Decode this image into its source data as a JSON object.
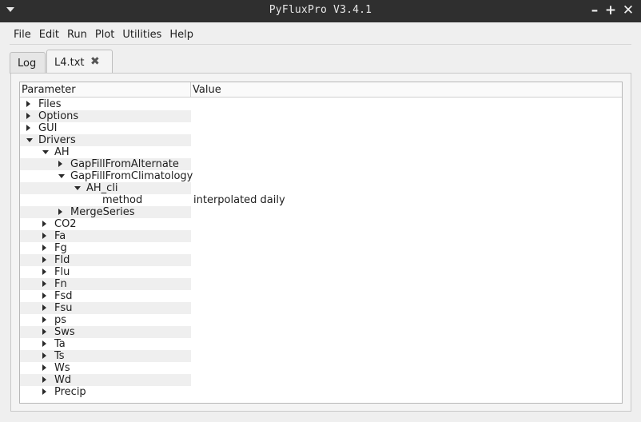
{
  "window": {
    "title": "PyFluxPro V3.4.1"
  },
  "menu": [
    "File",
    "Edit",
    "Run",
    "Plot",
    "Utilities",
    "Help"
  ],
  "tabs": {
    "log": "Log",
    "active": "L4.txt"
  },
  "tree": {
    "headers": {
      "parameter": "Parameter",
      "value": "Value"
    },
    "rows": [
      {
        "label": "Files",
        "level": 0,
        "state": "collapsed"
      },
      {
        "label": "Options",
        "level": 0,
        "state": "collapsed"
      },
      {
        "label": "GUI",
        "level": 0,
        "state": "collapsed"
      },
      {
        "label": "Drivers",
        "level": 0,
        "state": "expanded"
      },
      {
        "label": "AH",
        "level": 1,
        "state": "expanded"
      },
      {
        "label": "GapFillFromAlternate",
        "level": 2,
        "state": "collapsed"
      },
      {
        "label": "GapFillFromClimatology",
        "level": 2,
        "state": "expanded"
      },
      {
        "label": "AH_cli",
        "level": 3,
        "state": "expanded"
      },
      {
        "label": "method",
        "level": 4,
        "state": "leaf",
        "value": "interpolated daily"
      },
      {
        "label": "MergeSeries",
        "level": 2,
        "state": "collapsed"
      },
      {
        "label": "CO2",
        "level": 1,
        "state": "collapsed"
      },
      {
        "label": "Fa",
        "level": 1,
        "state": "collapsed"
      },
      {
        "label": "Fg",
        "level": 1,
        "state": "collapsed"
      },
      {
        "label": "Fld",
        "level": 1,
        "state": "collapsed"
      },
      {
        "label": "Flu",
        "level": 1,
        "state": "collapsed"
      },
      {
        "label": "Fn",
        "level": 1,
        "state": "collapsed"
      },
      {
        "label": "Fsd",
        "level": 1,
        "state": "collapsed"
      },
      {
        "label": "Fsu",
        "level": 1,
        "state": "collapsed"
      },
      {
        "label": "ps",
        "level": 1,
        "state": "collapsed"
      },
      {
        "label": "Sws",
        "level": 1,
        "state": "collapsed"
      },
      {
        "label": "Ta",
        "level": 1,
        "state": "collapsed"
      },
      {
        "label": "Ts",
        "level": 1,
        "state": "collapsed"
      },
      {
        "label": "Ws",
        "level": 1,
        "state": "collapsed"
      },
      {
        "label": "Wd",
        "level": 1,
        "state": "collapsed"
      },
      {
        "label": "Precip",
        "level": 1,
        "state": "collapsed"
      }
    ]
  }
}
